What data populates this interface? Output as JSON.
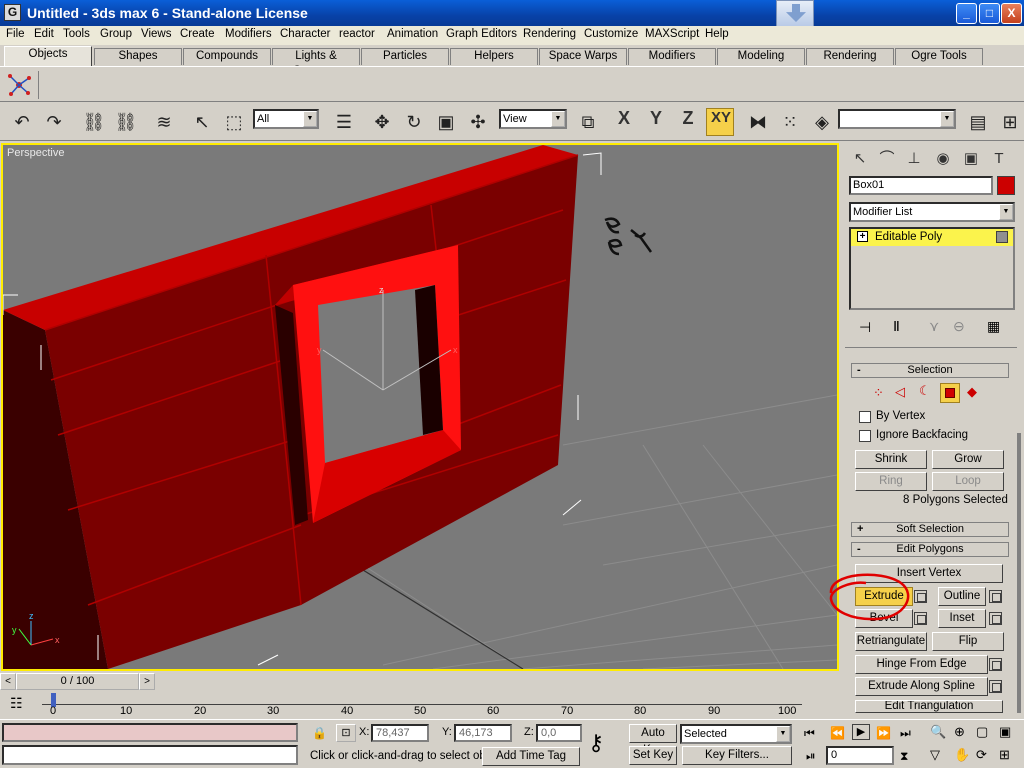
{
  "window": {
    "title": "Untitled - 3ds max 6 - Stand-alone License",
    "app_icon": "G",
    "minimize": "_",
    "maximize": "□",
    "close": "X"
  },
  "menu": [
    "File",
    "Edit",
    "Tools",
    "Group",
    "Views",
    "Create",
    "Modifiers",
    "Character",
    "reactor",
    "Animation",
    "Graph Editors",
    "Rendering",
    "Customize",
    "MAXScript",
    "Help"
  ],
  "tabs": [
    "Objects",
    "Shapes",
    "Compounds",
    "Lights & Cameras",
    "Particles",
    "Helpers",
    "Space Warps",
    "Modifiers",
    "Modeling",
    "Rendering",
    "Ogre Tools"
  ],
  "toolbar": {
    "selection_filter": "All",
    "reference_coord": "View",
    "axis_x": "X",
    "axis_y": "Y",
    "axis_z": "Z",
    "axis_xy": "XY"
  },
  "viewport": {
    "label": "Perspective",
    "axis_x": "x",
    "axis_y": "y",
    "axis_z": "z"
  },
  "command_panel": {
    "object_name": "Box01",
    "object_color": "#cc0000",
    "modifier_list": "Modifier List",
    "stack_item": "Editable Poly",
    "stack_item_toggle": "+",
    "selection_rollout": "Selection",
    "by_vertex": "By Vertex",
    "ignore_backfacing": "Ignore Backfacing",
    "shrink": "Shrink",
    "grow": "Grow",
    "ring": "Ring",
    "loop": "Loop",
    "selection_status": "8 Polygons Selected",
    "soft_selection_rollout": "Soft Selection",
    "edit_polygons_rollout": "Edit Polygons",
    "insert_vertex": "Insert Vertex",
    "extrude": "Extrude",
    "outline": "Outline",
    "bevel": "Bevel",
    "inset": "Inset",
    "retriangulate": "Retriangulate",
    "flip": "Flip",
    "hinge_from_edge": "Hinge From Edge",
    "extrude_along_spline": "Extrude Along Spline",
    "edit_triangulation": "Edit Triangulation"
  },
  "timeline": {
    "frame_counter": "0 / 100",
    "ticks": [
      "0",
      "10",
      "20",
      "30",
      "40",
      "50",
      "60",
      "70",
      "80",
      "90",
      "100"
    ]
  },
  "status": {
    "x_label": "X:",
    "x_value": "78,437",
    "y_label": "Y:",
    "y_value": "46,173",
    "z_label": "Z:",
    "z_value": "0,0",
    "prompt": "Click or click-and-drag to select obj",
    "add_time_tag": "Add Time Tag",
    "auto_key": "Auto Key",
    "set_key": "Set Key",
    "key_mode": "Selected",
    "key_filters": "Key Filters...",
    "current_frame": "0"
  }
}
